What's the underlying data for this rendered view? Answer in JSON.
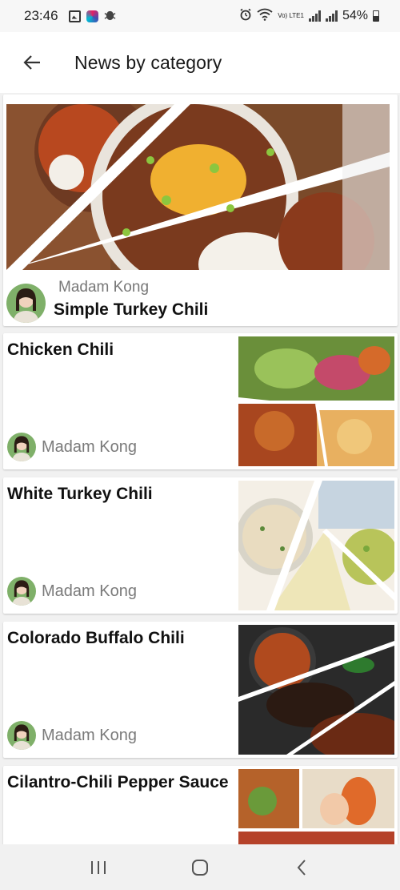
{
  "status_bar": {
    "time": "23:46",
    "network_label": "Vo) LTE1",
    "battery": "54%",
    "icons": [
      "gallery-icon",
      "app-icon",
      "bug-icon",
      "alarm-icon",
      "wifi-icon",
      "signal-icon",
      "battery-icon"
    ]
  },
  "header": {
    "title": "News by category",
    "back_icon": "arrow-left-icon"
  },
  "featured": {
    "author": "Madam Kong",
    "title": "Simple Turkey Chili"
  },
  "items": [
    {
      "title": "Chicken Chili",
      "author": "Madam Kong"
    },
    {
      "title": "White Turkey Chili",
      "author": "Madam Kong"
    },
    {
      "title": "Colorado Buffalo Chili",
      "author": "Madam Kong"
    },
    {
      "title": "Cilantro-Chili Pepper Sauce",
      "author": ""
    }
  ],
  "nav_bar": {
    "icons": [
      "recent-apps-icon",
      "home-icon",
      "back-icon"
    ]
  },
  "colors": {
    "background": "#f1f1f1",
    "card": "#ffffff",
    "title_text": "#111111",
    "author_text": "#7a7a7a"
  }
}
